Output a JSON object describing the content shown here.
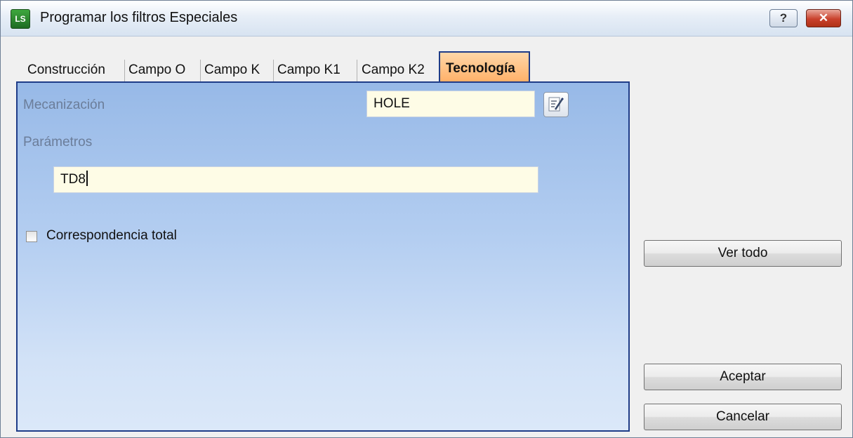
{
  "window": {
    "title": "Programar los filtros Especiales",
    "app_icon_text": "LS",
    "help_label": "?",
    "close_label": "✕"
  },
  "tabs": [
    {
      "label": "Construcción",
      "active": false
    },
    {
      "label": "Campo O",
      "active": false
    },
    {
      "label": "Campo K",
      "active": false
    },
    {
      "label": "Campo K1",
      "active": false
    },
    {
      "label": "Campo K2",
      "active": false
    },
    {
      "label": "Tecnología",
      "active": true
    }
  ],
  "form": {
    "mecanizacion_label": "Mecanización",
    "mecanizacion_value": "HOLE",
    "parametros_label": "Parámetros",
    "parametros_value": "TD8",
    "correspondencia_label": "Correspondencia total",
    "correspondencia_checked": false
  },
  "buttons": {
    "ver_todo": "Ver todo",
    "aceptar": "Aceptar",
    "cancelar": "Cancelar"
  },
  "colors": {
    "active_tab": "#ffb068",
    "panel_border": "#1f3c87",
    "field_background": "#fefce6"
  }
}
